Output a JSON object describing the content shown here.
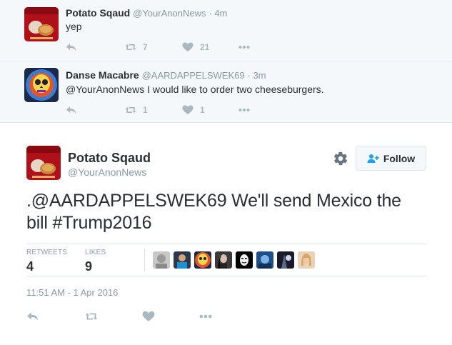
{
  "colors": {
    "icon_gray": "#aab8c2",
    "meta_gray": "#8899a6",
    "text": "#292f33",
    "border": "#e1e8ed",
    "bg_convo": "#f5f8fa",
    "follow_blue": "#1da1f2"
  },
  "replies": [
    {
      "name": "Potato Sqaud",
      "handle": "@YourAnonNews",
      "time": "4m",
      "text": "yep",
      "retweets": "7",
      "likes": "21",
      "avatar": "potato-avatar"
    },
    {
      "name": "Danse Macabre",
      "handle": "@AARDAPPELSWEK69",
      "time": "3m",
      "text": "@YourAnonNews I would like to order two cheeseburgers.",
      "retweets": "1",
      "likes": "1",
      "avatar": "skull-avatar"
    }
  ],
  "main_tweet": {
    "name": "Potato Sqaud",
    "handle": "@YourAnonNews",
    "follow_label": "Follow",
    "text": ".@AARDAPPELSWEK69 We'll send Mexico the bill #Trump2016",
    "retweets_label": "RETWEETS",
    "retweets": "4",
    "likes_label": "LIKES",
    "likes": "9",
    "timestamp": "11:51 AM - 1 Apr 2016",
    "liker_avatars": [
      "gray-avatar",
      "blue-person-avatar",
      "skull-avatar",
      "woman-avatar",
      "anonymous-mask-avatar",
      "blue-art-avatar",
      "dark-art-avatar",
      "blonde-avatar"
    ]
  },
  "icons": {
    "reply": "reply-icon",
    "retweet": "retweet-icon",
    "like": "heart-icon",
    "more": "more-dots-icon",
    "settings": "gear-icon",
    "follow": "follow-person-icon"
  }
}
